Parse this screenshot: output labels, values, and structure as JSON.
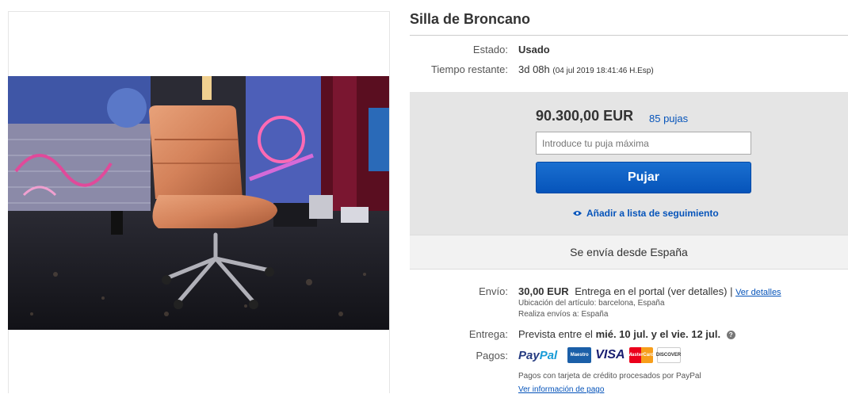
{
  "item": {
    "title": "Silla de Broncano",
    "condition_label": "Estado:",
    "condition_value": "Usado",
    "time_label": "Tiempo restante:",
    "time_value": "3d 08h",
    "time_end": "(04 jul 2019   18:41:46 H.Esp)"
  },
  "bid": {
    "price": "90.300,00 EUR",
    "bids_count": "85 pujas",
    "input_placeholder": "Introduce tu puja máxima",
    "button_label": "Pujar",
    "watch_label": "Añadir a lista de seguimiento"
  },
  "ships_from": "Se envía desde España",
  "shipping": {
    "label": "Envío:",
    "cost": "30,00 EUR",
    "method": "Entrega en el portal (ver detalles)",
    "separator": "|",
    "details_link": "Ver detalles",
    "location_line": "Ubicación del artículo:  barcelona, España",
    "ships_to_line": "Realiza envíos a:  España"
  },
  "delivery": {
    "label": "Entrega:",
    "prefix": "Prevista entre el",
    "date_range": "mié. 10 jul. y el vie. 12 jul.",
    "help_icon": "?"
  },
  "payments": {
    "label": "Pagos:",
    "paypal_pay": "Pay",
    "paypal_pal": "Pal",
    "maestro": "Maestro",
    "visa": "VISA",
    "mastercard": "MasterCard",
    "discover": "DISCOVER",
    "note": "Pagos con tarjeta de crédito procesados por PayPal",
    "info_link": "Ver información de pago"
  },
  "colors": {
    "link": "#0654ba",
    "bid_panel": "#e5e5e5",
    "chair_leather": "#d4825a"
  }
}
